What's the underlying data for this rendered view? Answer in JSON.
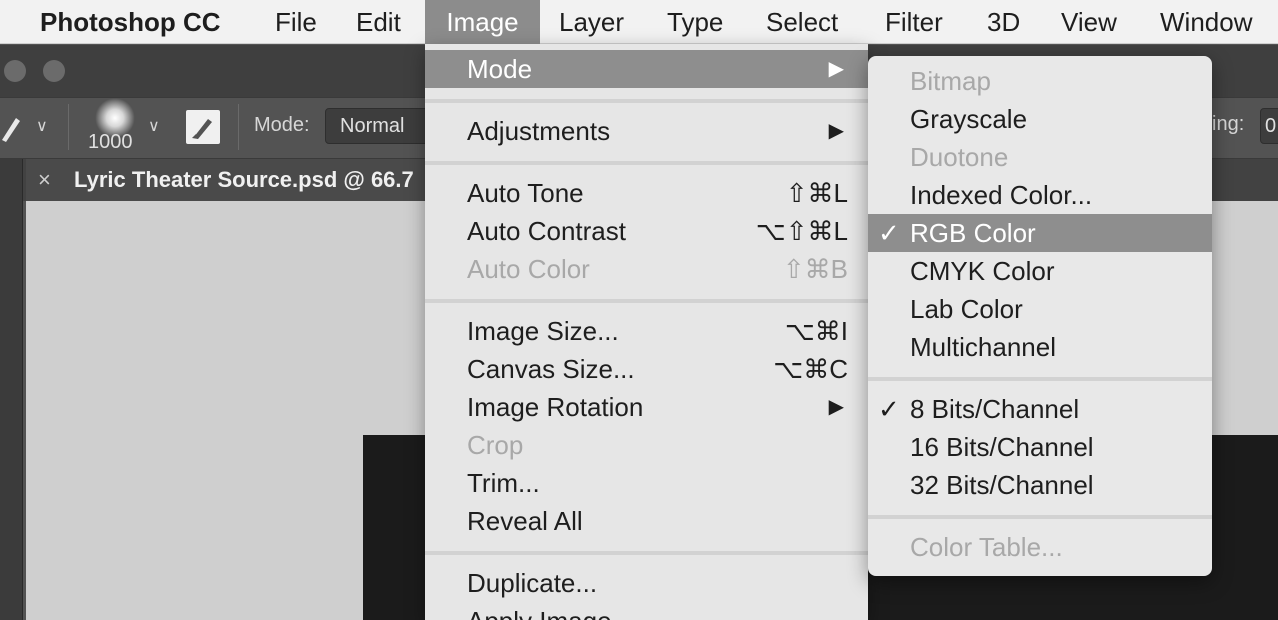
{
  "menubar": {
    "app": "Photoshop CC",
    "items": [
      "File",
      "Edit",
      "Image",
      "Layer",
      "Type",
      "Select",
      "Filter",
      "3D",
      "View",
      "Window"
    ],
    "active": "Image"
  },
  "options_bar": {
    "brush_size": "1000",
    "mode_label": "Mode:",
    "mode_value": "Normal",
    "right_label_partial": "ing:",
    "right_value_partial": "0"
  },
  "document_tab": {
    "title": "Lyric Theater Source.psd @ 66.7",
    "close_glyph": "×"
  },
  "image_menu": {
    "items": [
      {
        "label": "Mode",
        "submenu": true,
        "highlighted": true
      },
      {
        "label": "Adjustments",
        "submenu": true
      },
      {
        "label": "Auto Tone",
        "shortcut": "⇧⌘L"
      },
      {
        "label": "Auto Contrast",
        "shortcut": "⌥⇧⌘L"
      },
      {
        "label": "Auto Color",
        "shortcut": "⇧⌘B",
        "disabled": true
      },
      {
        "label": "Image Size...",
        "shortcut": "⌥⌘I"
      },
      {
        "label": "Canvas Size...",
        "shortcut": "⌥⌘C"
      },
      {
        "label": "Image Rotation",
        "submenu": true
      },
      {
        "label": "Crop",
        "disabled": true
      },
      {
        "label": "Trim..."
      },
      {
        "label": "Reveal All"
      },
      {
        "label": "Duplicate..."
      },
      {
        "label": "Apply Image..."
      }
    ],
    "arrow_glyph": "▶"
  },
  "mode_submenu": {
    "items": [
      {
        "label": "Bitmap",
        "disabled": true
      },
      {
        "label": "Grayscale"
      },
      {
        "label": "Duotone",
        "disabled": true
      },
      {
        "label": "Indexed Color..."
      },
      {
        "label": "RGB Color",
        "checked": true,
        "highlighted": true
      },
      {
        "label": "CMYK Color"
      },
      {
        "label": "Lab Color"
      },
      {
        "label": "Multichannel"
      },
      {
        "label": "8 Bits/Channel",
        "checked": true
      },
      {
        "label": "16 Bits/Channel"
      },
      {
        "label": "32 Bits/Channel"
      },
      {
        "label": "Color Table...",
        "disabled": true
      }
    ],
    "check_glyph": "✓"
  },
  "colors": {
    "menubar_bg": "#f2f2f2",
    "menu_bg": "#e6e6e6",
    "highlight": "#8e8e8e",
    "disabled_text": "#a8a8a8",
    "ps_dark": "#535353"
  }
}
